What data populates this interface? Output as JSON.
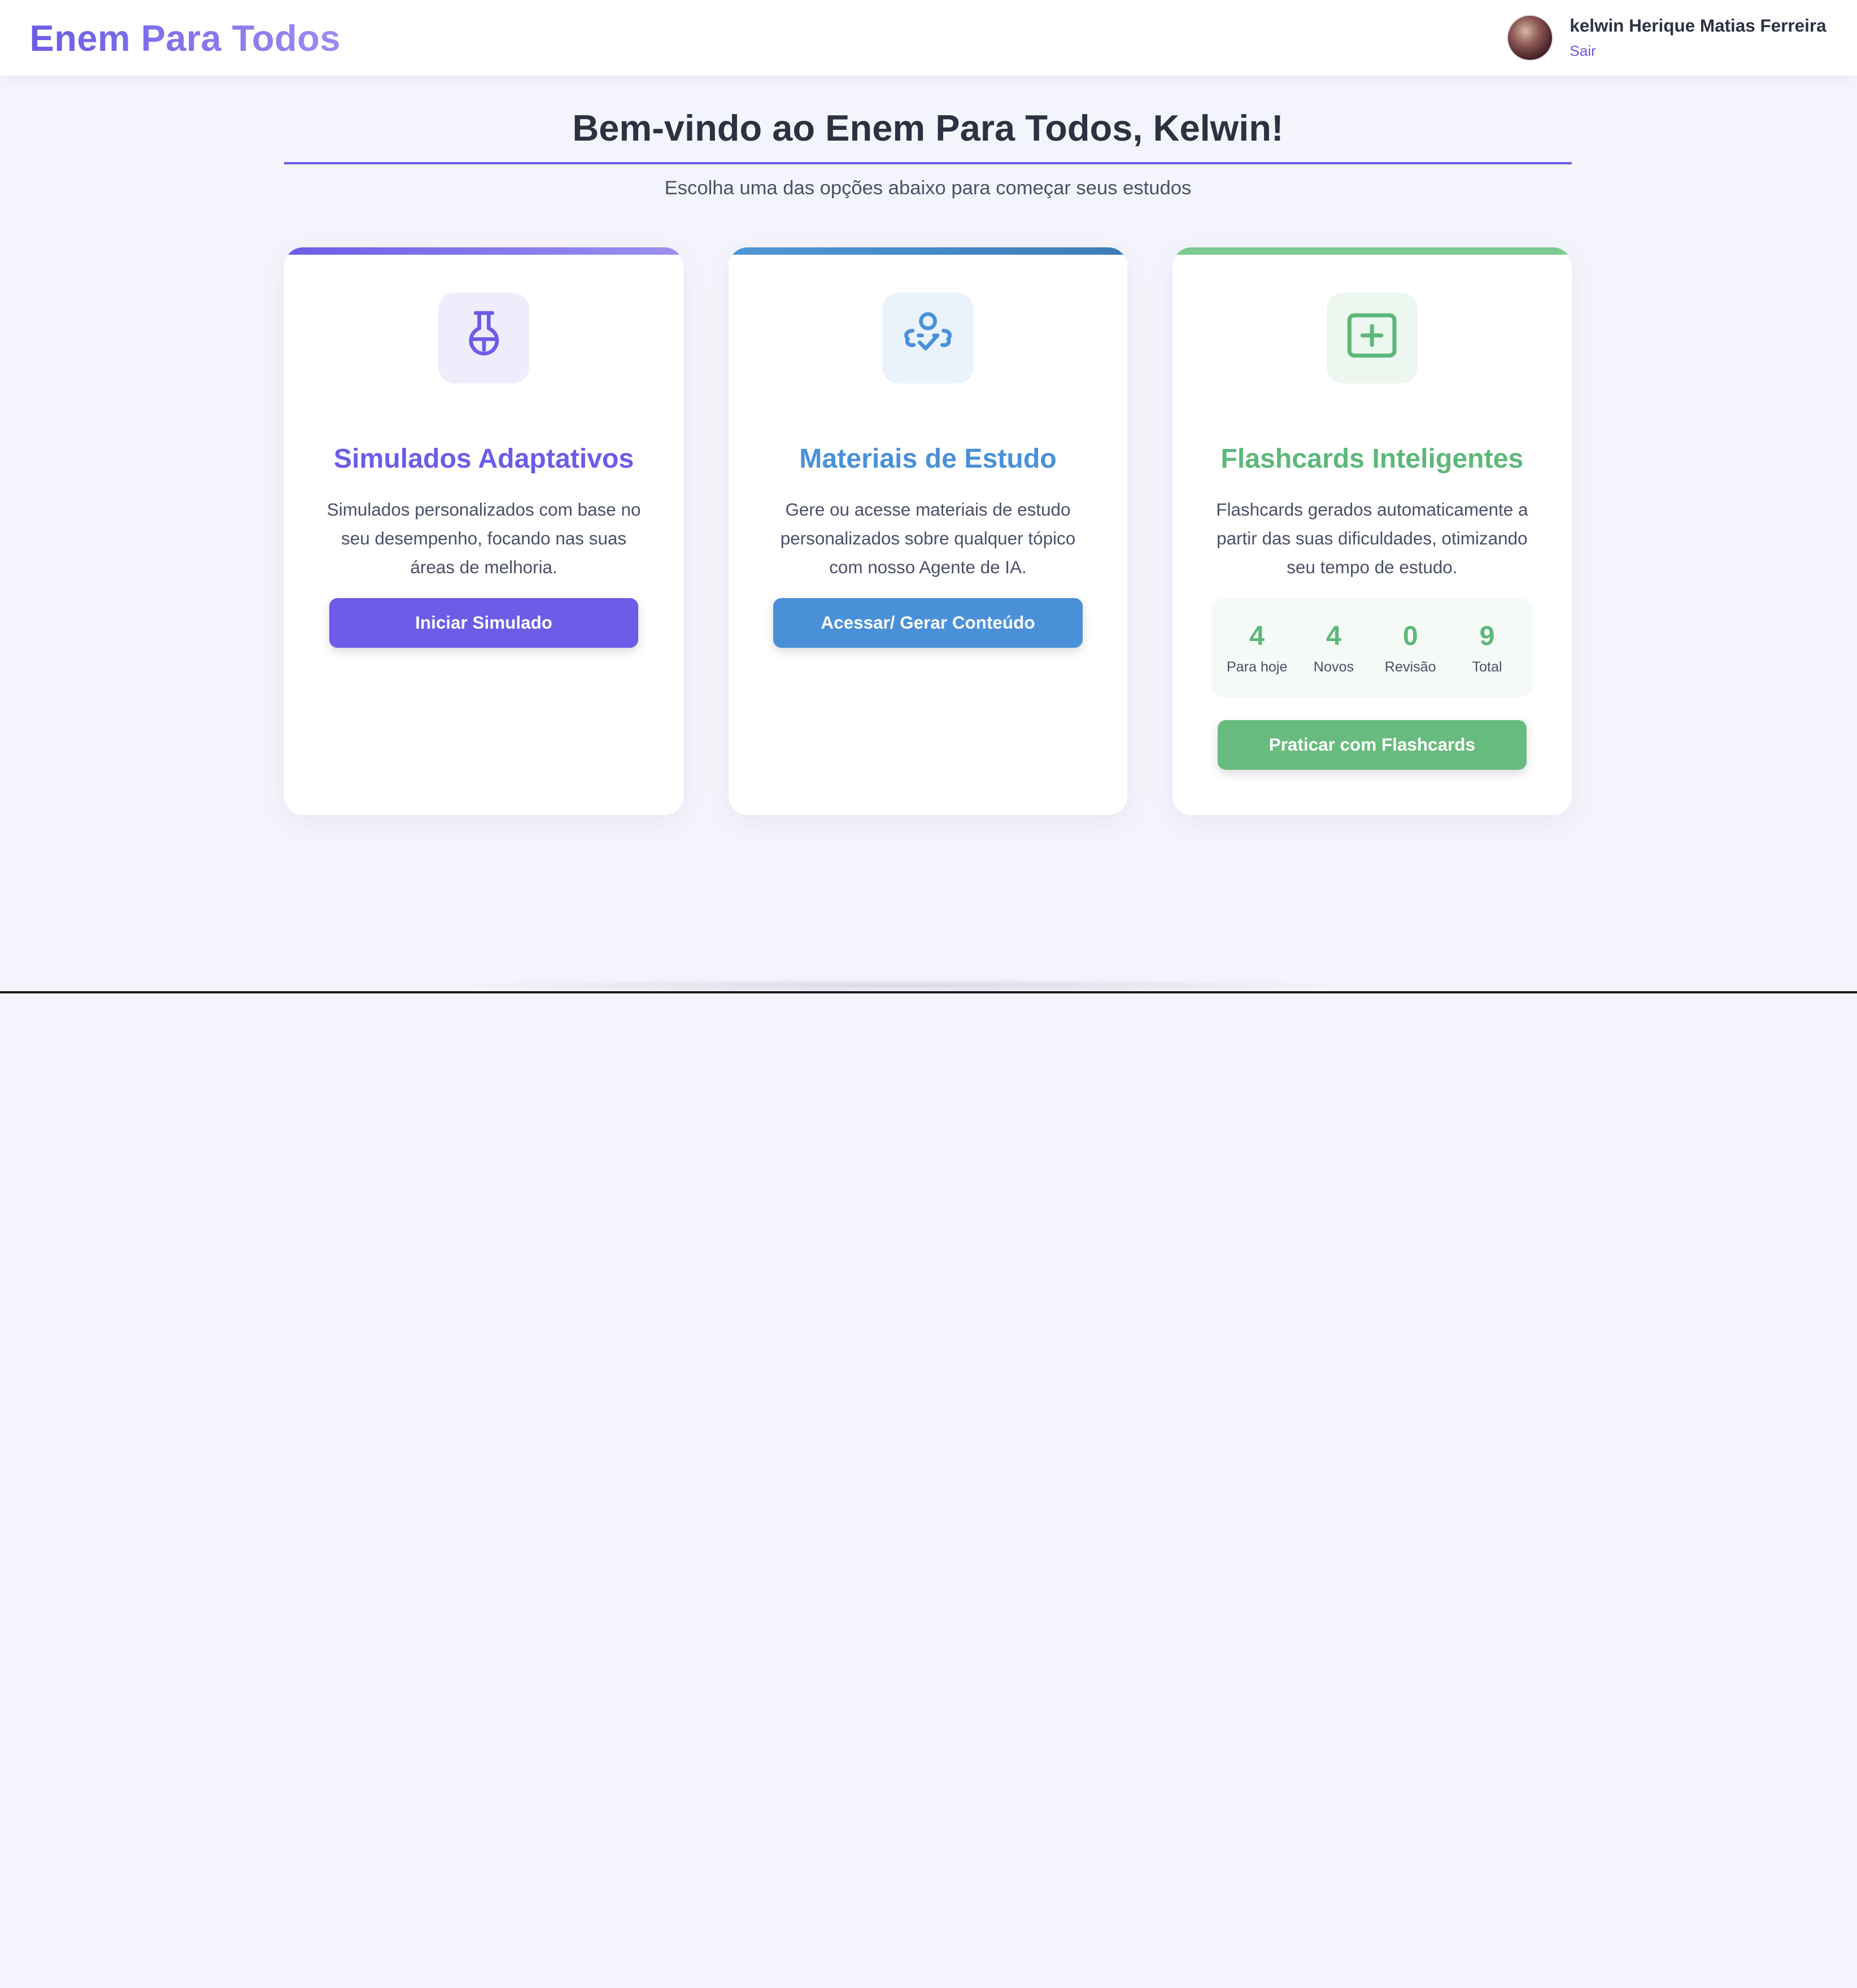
{
  "header": {
    "brand": "Enem Para Todos",
    "user_name": "kelwin Herique Matias Ferreira",
    "logout_label": "Sair"
  },
  "welcome": {
    "title": "Bem-vindo ao Enem Para Todos, Kelwin!",
    "subtitle": "Escolha uma das opções abaixo para começar seus estudos"
  },
  "cards": [
    {
      "icon": "flask-icon",
      "title": "Simulados Adaptativos",
      "description": "Simulados personalizados com base no seu desempenho, focando nas suas áreas de melhoria.",
      "button_label": "Iniciar Simulado",
      "accent": "#6c5ce7"
    },
    {
      "icon": "brain-check-icon",
      "title": "Materiais de Estudo",
      "description": "Gere ou acesse materiais de estudo personalizados sobre qualquer tópico com nosso Agente de IA.",
      "button_label": "Acessar/ Gerar Conteúdo",
      "accent": "#4a90d9"
    },
    {
      "icon": "plus-square-icon",
      "title": "Flashcards Inteligentes",
      "description": "Flashcards gerados automaticamente a partir das suas dificuldades, otimizando seu tempo de estudo.",
      "button_label": "Praticar com Flashcards",
      "accent": "#5cb87a",
      "stats": [
        {
          "value": "4",
          "label": "Para hoje"
        },
        {
          "value": "4",
          "label": "Novos"
        },
        {
          "value": "0",
          "label": "Revisão"
        },
        {
          "value": "9",
          "label": "Total"
        }
      ]
    }
  ]
}
